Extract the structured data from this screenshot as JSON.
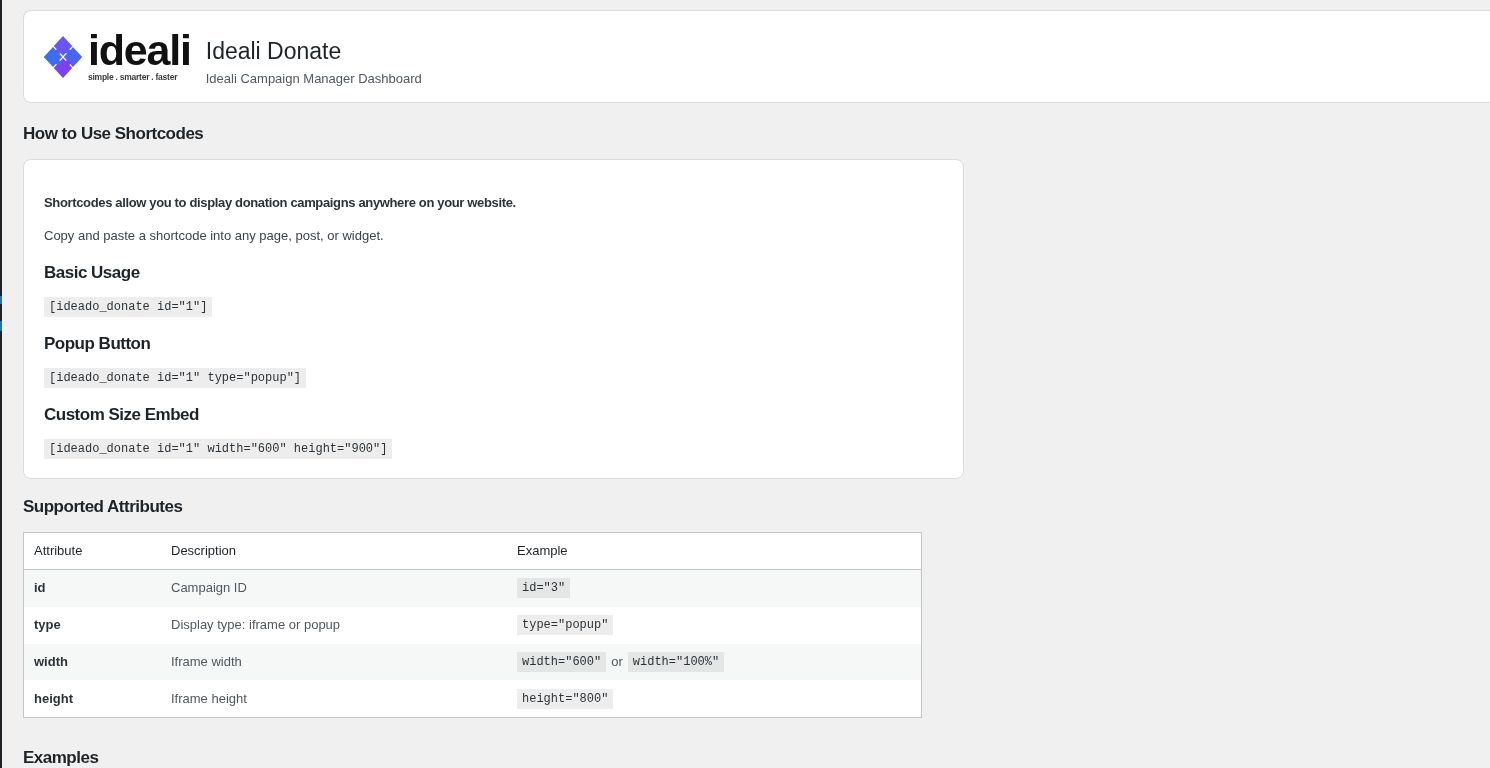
{
  "header": {
    "logo": {
      "wordmark": "ideali",
      "tagline": "simple . smarter . faster"
    },
    "title": "Ideali Donate",
    "subtitle": "Ideali Campaign Manager Dashboard"
  },
  "shortcodes": {
    "heading": "How to Use Shortcodes",
    "blocks": [
      {
        "kind": "lead",
        "text": "Shortcodes allow you to display donation campaigns anywhere on your website."
      },
      {
        "kind": "paragraph",
        "text": "Copy and paste a shortcode into any page, post, or widget."
      },
      {
        "kind": "subheading",
        "text": "Basic Usage"
      },
      {
        "kind": "code",
        "text": "[ideado_donate id=\"1\"]"
      },
      {
        "kind": "subheading",
        "text": "Popup Button"
      },
      {
        "kind": "code",
        "text": "[ideado_donate id=\"1\" type=\"popup\"]"
      },
      {
        "kind": "subheading",
        "text": "Custom Size Embed"
      },
      {
        "kind": "code",
        "text": "[ideado_donate id=\"1\" width=\"600\" height=\"900\"]"
      }
    ]
  },
  "attributes": {
    "heading": "Supported Attributes",
    "columns": [
      "Attribute",
      "Description",
      "Example"
    ],
    "rows": [
      {
        "attribute": "id",
        "description": "Campaign ID",
        "example": [
          {
            "kind": "code",
            "text": "id=\"3\""
          }
        ]
      },
      {
        "attribute": "type",
        "description": "Display type: iframe or popup",
        "example": [
          {
            "kind": "code",
            "text": "type=\"popup\""
          }
        ]
      },
      {
        "attribute": "width",
        "description": "Iframe width",
        "example": [
          {
            "kind": "code",
            "text": "width=\"600\""
          },
          {
            "kind": "text",
            "text": "or"
          },
          {
            "kind": "code",
            "text": "width=\"100%\""
          }
        ]
      },
      {
        "attribute": "height",
        "description": "Iframe height",
        "example": [
          {
            "kind": "code",
            "text": "height=\"800\""
          }
        ]
      }
    ]
  },
  "examples": {
    "heading": "Examples"
  }
}
